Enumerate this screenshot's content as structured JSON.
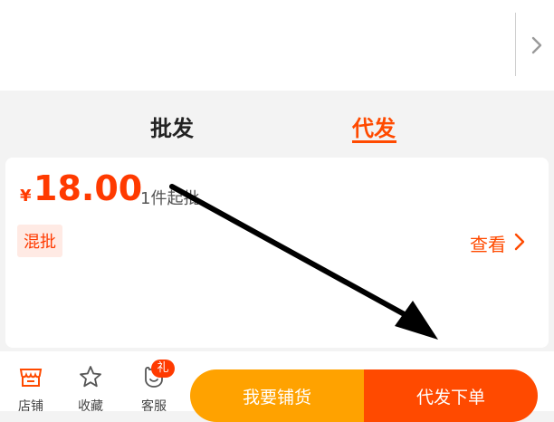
{
  "tabs": {
    "wholesale_label": "批发",
    "dropship_label": "代发",
    "active": "代发"
  },
  "pricing": {
    "currency_symbol": "¥",
    "price": "18.00",
    "min_order": "1件起批",
    "badge": "混批",
    "view_label": "查看"
  },
  "bottom_nav": {
    "store_label": "店铺",
    "favorite_label": "收藏",
    "service_label": "客服",
    "gift_badge": "礼"
  },
  "actions": {
    "stock_label": "我要铺货",
    "dropship_order_label": "代发下单"
  },
  "colors": {
    "accent": "#ff4a00",
    "price": "#ff3a00",
    "stock_button": "#ffa200",
    "dropship_button": "#ff4a00"
  },
  "icons": [
    "chevron-right-icon",
    "store-icon",
    "star-icon",
    "customer-service-icon",
    "annotation-arrow"
  ]
}
